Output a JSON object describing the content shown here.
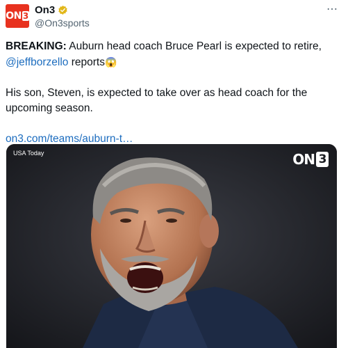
{
  "account": {
    "display_name": "On3",
    "handle": "@On3sports",
    "avatar_text_main": "ON",
    "avatar_text_num": "3",
    "brand_color": "#e8321f",
    "verified_color": "#e2b719"
  },
  "tweet": {
    "breaking_label": "BREAKING:",
    "line1_rest": " Auburn head coach Bruce Pearl is expected to retire, ",
    "mention": "@jeffborzello",
    "reports": " reports",
    "emoji": "😱",
    "paragraph2": "His son, Steven, is expected to take over as head coach for the upcoming season.",
    "link_text": "on3.com/teams/auburn-t…"
  },
  "media": {
    "credit": "USA Today",
    "logo_text": "ON",
    "logo_num": "3"
  },
  "icons": {
    "more": "more-options-icon",
    "verified": "verified-badge-icon"
  }
}
